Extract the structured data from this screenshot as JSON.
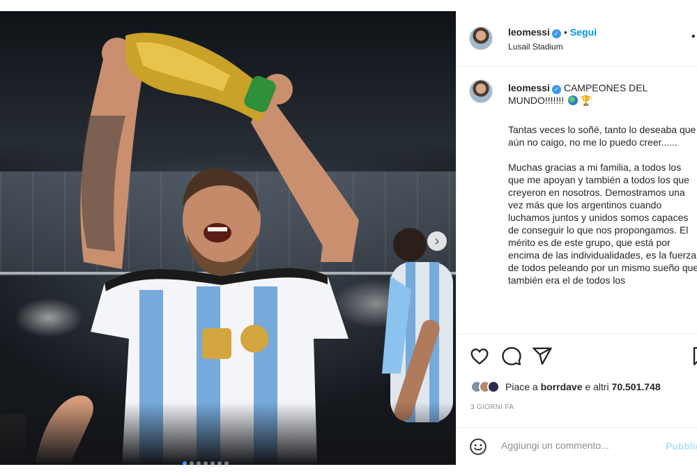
{
  "post": {
    "username": "leomessi",
    "follow_label": "Segui",
    "separator": "•",
    "location": "Lusail Stadium"
  },
  "caption": {
    "username": "leomessi",
    "first_line": "CAMPEONES DEL MUNDO!!!!!!!",
    "paragraphs": [
      "Tantas veces lo soñé, tanto lo deseaba que aún no caigo, no me lo puedo creer......",
      "Muchas gracias a mi familia, a todos los que me apoyan y también a todos los que creyeron en nosotros. Demostramos una vez más que los argentinos cuando luchamos juntos y unidos somos capaces de conseguir lo que nos propongamos. El mérito es de este grupo, que está por encima de las individualidades, es la fuerza de todos peleando por un mismo sueño que también era el de todos los"
    ]
  },
  "likes": {
    "prefix": "Piace a",
    "user": "borrdave",
    "middle": "e altri",
    "count": "70.501.748"
  },
  "time_ago": "3 GIORNI FA",
  "comment": {
    "placeholder": "Aggiungi un commento...",
    "publish_label": "Pubblica"
  },
  "carousel": {
    "slide_count": 7,
    "active_index": 0
  },
  "colors": {
    "link_blue": "#0095f6",
    "verified_blue": "#3897f0",
    "publish_disabled": "#b2dffc",
    "muted_text": "#8e8e8e"
  },
  "icons": {
    "verified": "verified-badge-icon",
    "more": "more-options-icon",
    "like": "heart-icon",
    "comment": "comment-icon",
    "share": "share-icon",
    "save": "bookmark-icon",
    "emoji": "smile-icon",
    "next": "chevron-right-icon"
  }
}
